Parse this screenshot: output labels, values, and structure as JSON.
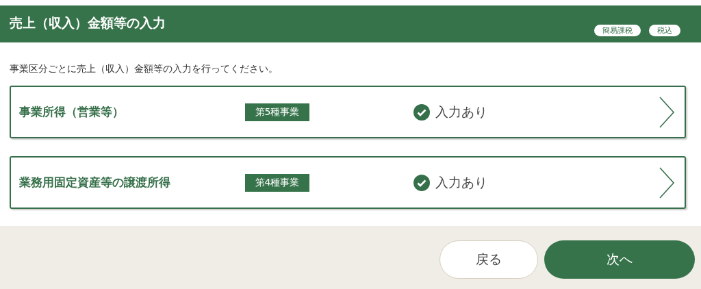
{
  "header": {
    "title": "売上（収入）金額等の入力",
    "tags": [
      "簡易課税",
      "税込"
    ]
  },
  "instruction": "事業区分ごとに売上（収入）金額等の入力を行ってください。",
  "items": [
    {
      "name": "事業所得（営業等）",
      "category": "第5種事業",
      "status": "入力あり"
    },
    {
      "name": "業務用固定資産等の譲渡所得",
      "category": "第4種事業",
      "status": "入力あり"
    }
  ],
  "buttons": {
    "back": "戻る",
    "next": "次へ"
  }
}
